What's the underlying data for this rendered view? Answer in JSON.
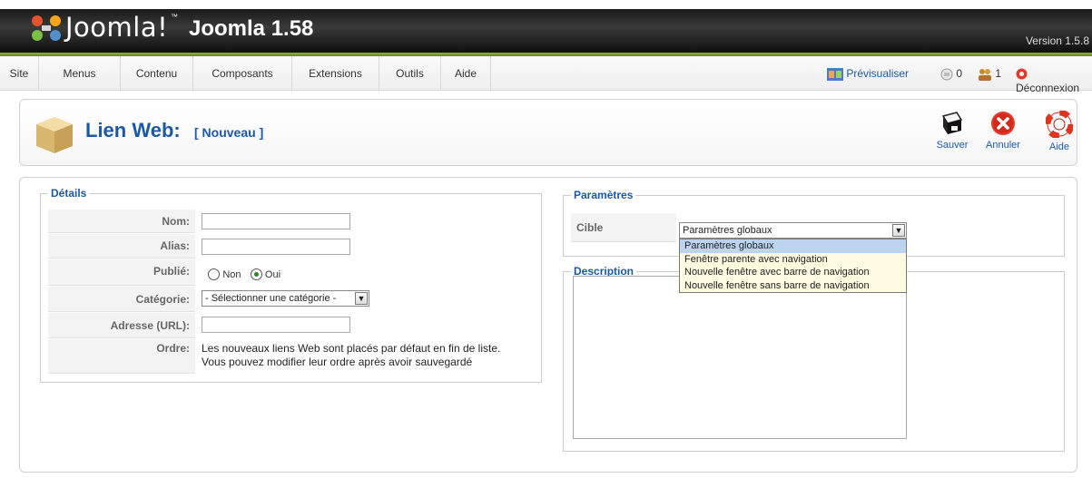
{
  "header": {
    "logo_text": "Joomla!",
    "logo_tm": "™",
    "site_title": "Joomla 1.58",
    "version": "Version 1.5.8"
  },
  "menu": {
    "items": [
      "Site",
      "Menus",
      "Contenu",
      "Composants",
      "Extensions",
      "Outils",
      "Aide"
    ],
    "preview_label": "Prévisualiser",
    "messages_count": "0",
    "users_count": "1",
    "logout_label": "Déconnexion"
  },
  "toolbar": {
    "title": "Lien Web:",
    "subtitle": "[ Nouveau ]",
    "save_label": "Sauver",
    "cancel_label": "Annuler",
    "help_label": "Aide"
  },
  "details": {
    "legend": "Détails",
    "name_label": "Nom:",
    "alias_label": "Alias:",
    "published_label": "Publié:",
    "published_no": "Non",
    "published_yes": "Oui",
    "category_label": "Catégorie:",
    "category_value": "- Sélectionner une catégorie -",
    "url_label": "Adresse (URL):",
    "order_label": "Ordre:",
    "order_text_1": "Les nouveaux liens Web sont placés par défaut en fin de liste.",
    "order_text_2": "Vous pouvez modifier leur ordre après avoir sauvegardé"
  },
  "params": {
    "legend": "Paramètres",
    "target_label": "Cible",
    "target_value": "Paramètres globaux",
    "target_options": [
      "Paramètres globaux",
      "Fenêtre parente avec navigation",
      "Nouvelle fenêtre avec barre de navigation",
      "Nouvelle fenêtre sans barre de navigation"
    ]
  },
  "description": {
    "legend": "Description"
  },
  "colors": {
    "accent_blue": "#1a58a8",
    "header_dark": "#1a1a1a",
    "green_line": "#6ca22e"
  }
}
